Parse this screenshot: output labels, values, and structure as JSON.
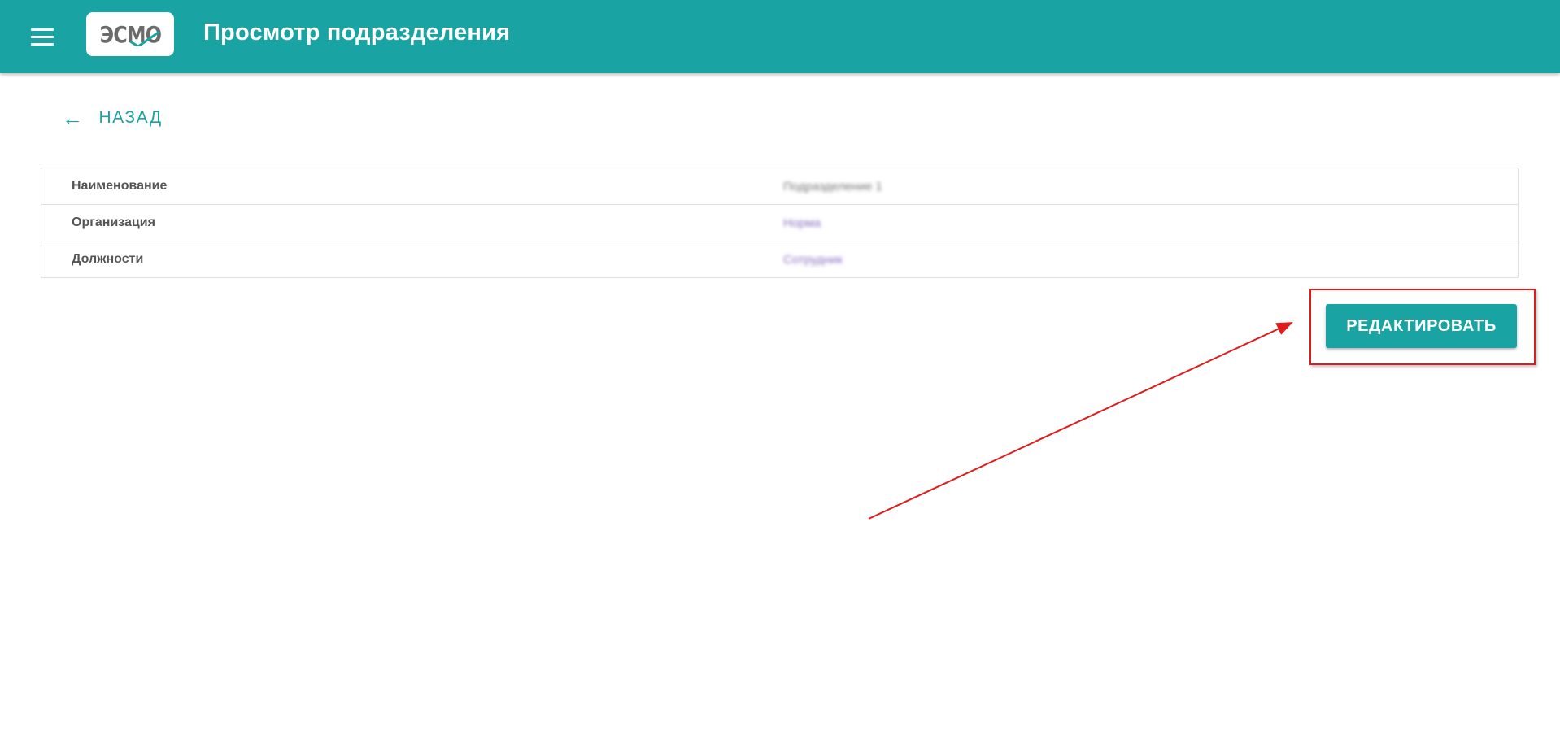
{
  "header": {
    "title": "Просмотр подразделения",
    "logo_text": "ЭСМО",
    "menu_icon": "hamburger-menu-icon",
    "brand_color": "#19a3a3"
  },
  "back": {
    "label": "НАЗАД",
    "icon": "arrow-left-icon"
  },
  "details": {
    "rows": [
      {
        "label": "Наименование",
        "value": "Подразделение 1"
      },
      {
        "label": "Организация",
        "value": "Норма"
      },
      {
        "label": "Должности",
        "value": "Сотрудник"
      }
    ]
  },
  "actions": {
    "edit_label": "РЕДАКТИРОВАТЬ"
  },
  "annotation": {
    "highlight_color": "#e01b1b"
  }
}
